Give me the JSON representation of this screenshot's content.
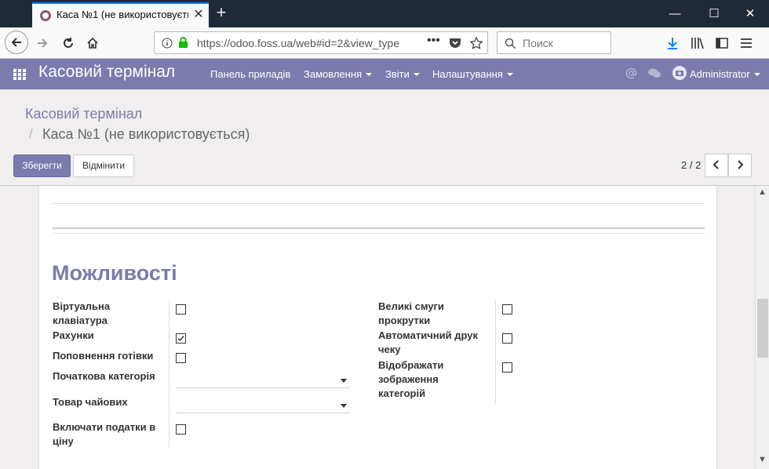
{
  "browser": {
    "tab_title": "Каса №1 (не використовується)",
    "tab_close": "✕",
    "new_tab": "+",
    "window_minimize": "—",
    "window_maximize": "☐",
    "window_close": "✕",
    "url": "https://odoo.foss.ua/web#id=2&view_type",
    "url_more": "•••",
    "search_placeholder": "Поиск"
  },
  "app": {
    "brand": "Касовий термінал",
    "menu": [
      "Панель приладів",
      "Замовлення",
      "Звіти",
      "Налаштування"
    ],
    "user": "Administrator",
    "accent_color": "#7c7bad"
  },
  "breadcrumb": {
    "parent": "Касовий термінал",
    "separator": "/",
    "current": "Каса №1 (не використовується)"
  },
  "buttons": {
    "save": "Зберегти",
    "discard": "Відмінити"
  },
  "pager": {
    "text": "2 / 2"
  },
  "section": {
    "title": "Можливості",
    "left_fields": [
      {
        "label": "Віртуальна клавіатура",
        "type": "checkbox",
        "checked": false
      },
      {
        "label": "Рахунки",
        "type": "checkbox",
        "checked": true
      },
      {
        "label": "Поповнення готівки",
        "type": "checkbox",
        "checked": false
      },
      {
        "label": "Початкова категорія",
        "type": "select",
        "value": ""
      },
      {
        "label": "Товар чайових",
        "type": "select",
        "value": ""
      },
      {
        "label": "Включати податки в ціну",
        "type": "checkbox",
        "checked": false
      }
    ],
    "right_fields": [
      {
        "label": "Великі смуги прокрутки",
        "type": "checkbox",
        "checked": false
      },
      {
        "label": "Автоматичний друк чеку",
        "type": "checkbox",
        "checked": false
      },
      {
        "label": "Відображати зображення категорій",
        "type": "checkbox",
        "checked": false
      }
    ]
  }
}
